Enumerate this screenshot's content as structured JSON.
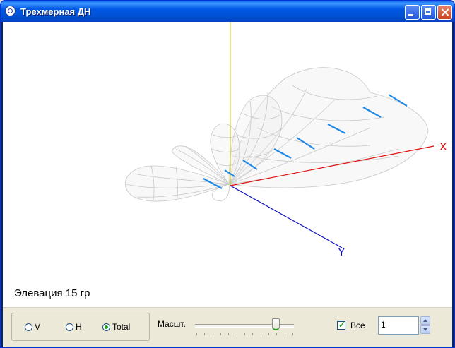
{
  "window": {
    "title": "Трехмерная ДН"
  },
  "viewport": {
    "axis_labels": {
      "x": "X",
      "y": "Y"
    },
    "elevation_text": "Элевация 15 гр",
    "colors": {
      "x_axis": "#e01010",
      "y_axis": "#1010c0",
      "z_axis": "#c8c800",
      "mesh": "#c8c8c8",
      "markers": "#1e88e6"
    }
  },
  "controls": {
    "radio": [
      {
        "label": "V",
        "selected": false
      },
      {
        "label": "H",
        "selected": false
      },
      {
        "label": "Total",
        "selected": true
      }
    ],
    "scale_label": "Масшт.",
    "scale_slider_fraction": 0.8,
    "all_checkbox": {
      "label": "Все",
      "checked": true
    },
    "spin_value": "1"
  }
}
